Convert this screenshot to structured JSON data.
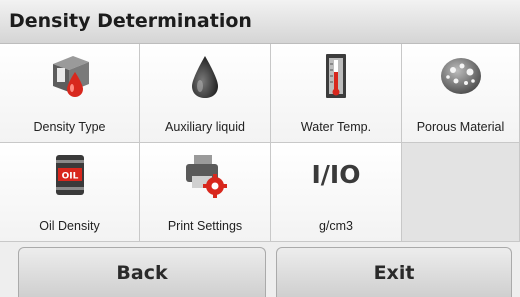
{
  "header": {
    "title": "Density Determination"
  },
  "menu": {
    "items": [
      {
        "label": "Density Type",
        "icon": "density-type-icon"
      },
      {
        "label": "Auxiliary liquid",
        "icon": "liquid-drop-icon"
      },
      {
        "label": "Water Temp.",
        "icon": "thermometer-icon"
      },
      {
        "label": "Porous Material",
        "icon": "porous-stone-icon"
      },
      {
        "label": "Oil Density",
        "icon": "oil-barrel-icon",
        "icon_text": "OIL"
      },
      {
        "label": "Print Settings",
        "icon": "printer-gear-icon"
      },
      {
        "label": "g/cm3",
        "icon": "io-icon",
        "icon_text": "I/IO"
      }
    ]
  },
  "footer": {
    "back_label": "Back",
    "exit_label": "Exit"
  },
  "colors": {
    "accent_red": "#d8271d",
    "header_bg": "#d8d8d8"
  }
}
